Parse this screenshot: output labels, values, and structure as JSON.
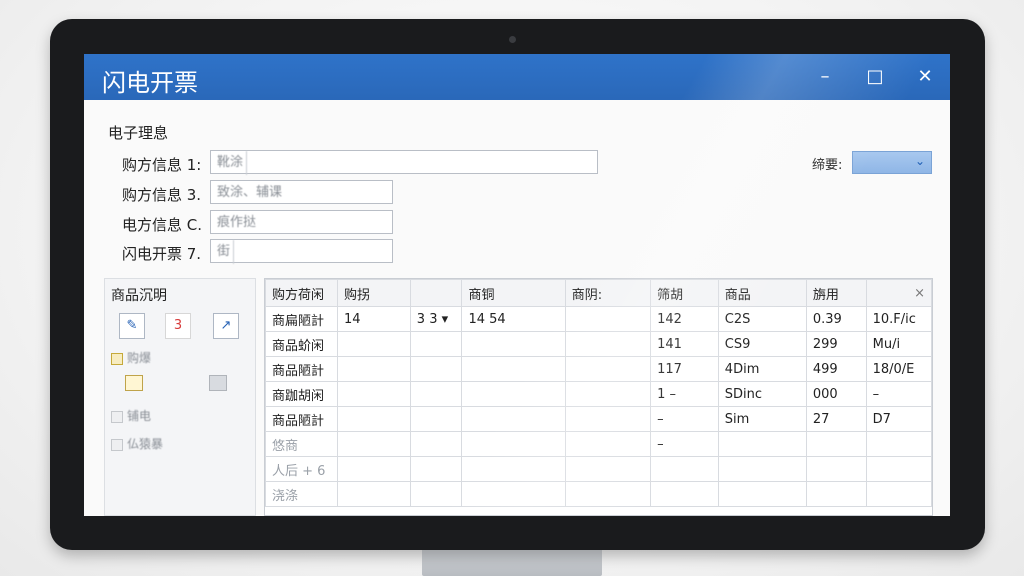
{
  "window": {
    "title": "闪电开票",
    "min": "–",
    "max": "□",
    "close": "✕"
  },
  "form": {
    "section": "电子理息",
    "rows": [
      {
        "label": "购方信息 1:",
        "value": "靴涂"
      },
      {
        "label": "购方信息 3.",
        "value": "致涂、辅课"
      },
      {
        "label": "电方信息 C.",
        "value": "痕作挞"
      },
      {
        "label": "闪电开票 7.",
        "value": "街"
      }
    ],
    "right_label": "缔要:"
  },
  "left_panel": {
    "title": "商品沉明",
    "tools": [
      "✎",
      "3",
      "↗"
    ],
    "checkbox_1": "购爆",
    "checkbox_2": "铺电",
    "checkbox_3": "仏猿暴"
  },
  "table": {
    "headers": [
      "购方荷闲",
      "购拐",
      "",
      "商铜",
      "商阴:",
      "筛胡",
      "商品",
      "旃用",
      "×"
    ],
    "rows": [
      [
        "商扁陋計",
        "14",
        "3 3  ▾",
        "14 54",
        "",
        "142",
        "C2S",
        "0.39",
        "10.F/ic"
      ],
      [
        "商品蚧闲",
        "",
        "",
        "",
        "",
        "141",
        "CS9",
        "299",
        "Mu/i"
      ],
      [
        "商品陋計",
        "",
        "",
        "",
        "",
        "117",
        "4Dim",
        "499",
        "18/0/E"
      ],
      [
        "商跏胡闲",
        "",
        "",
        "",
        "",
        "1 –",
        "SDinc",
        "000",
        "–"
      ],
      [
        "商品陋計",
        "",
        "",
        "",
        "",
        "–",
        "Sim",
        "27",
        "D7"
      ],
      [
        "悠商",
        "",
        "",
        "",
        "",
        "–",
        "",
        "",
        ""
      ],
      [
        "人后 + 6",
        "",
        "",
        "",
        "",
        "",
        "",
        "",
        ""
      ],
      [
        "浇涤",
        "",
        "",
        "",
        "",
        "",
        "",
        "",
        ""
      ]
    ]
  }
}
